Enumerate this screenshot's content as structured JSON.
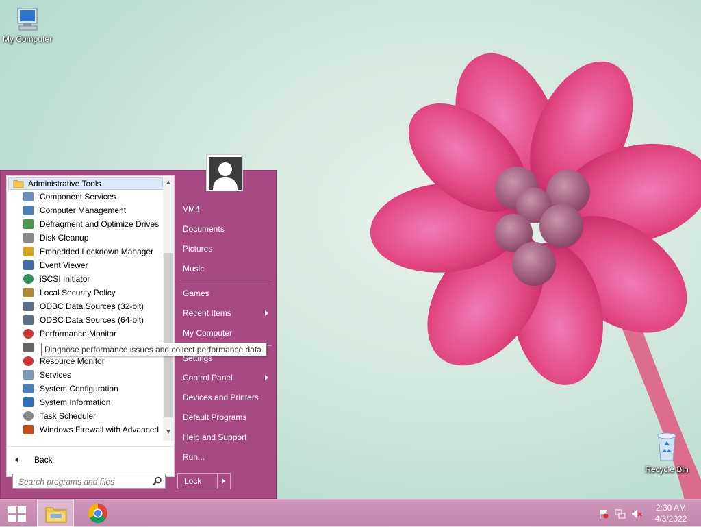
{
  "desktop": {
    "icons": [
      {
        "label": "My Computer",
        "icon": "computer-icon"
      },
      {
        "label": "Recycle Bin",
        "icon": "recycle-bin-icon"
      }
    ]
  },
  "start_menu": {
    "header": "Administrative Tools",
    "programs": [
      {
        "label": "Component Services",
        "icon": "component-services-icon"
      },
      {
        "label": "Computer Management",
        "icon": "computer-management-icon"
      },
      {
        "label": "Defragment and Optimize Drives",
        "icon": "defragment-icon"
      },
      {
        "label": "Disk Cleanup",
        "icon": "disk-cleanup-icon"
      },
      {
        "label": "Embedded Lockdown Manager",
        "icon": "lock-icon"
      },
      {
        "label": "Event Viewer",
        "icon": "event-viewer-icon"
      },
      {
        "label": "iSCSI Initiator",
        "icon": "globe-icon"
      },
      {
        "label": "Local Security Policy",
        "icon": "security-policy-icon"
      },
      {
        "label": "ODBC Data Sources (32-bit)",
        "icon": "odbc-icon"
      },
      {
        "label": "ODBC Data Sources (64-bit)",
        "icon": "odbc-icon"
      },
      {
        "label": "Performance Monitor",
        "icon": "performance-monitor-icon"
      },
      {
        "label": "",
        "icon": "print-management-icon"
      },
      {
        "label": "Resource Monitor",
        "icon": "resource-monitor-icon"
      },
      {
        "label": "Services",
        "icon": "services-gear-icon"
      },
      {
        "label": "System Configuration",
        "icon": "system-configuration-icon"
      },
      {
        "label": "System Information",
        "icon": "system-information-icon"
      },
      {
        "label": "Task Scheduler",
        "icon": "clock-icon"
      },
      {
        "label": "Windows Firewall with Advanced",
        "icon": "firewall-icon"
      }
    ],
    "back_label": "Back",
    "search_placeholder": "Search programs and files",
    "tooltip": "Diagnose performance issues and collect performance data.",
    "right_items": [
      {
        "label": "VM4",
        "arrow": false
      },
      {
        "label": "Documents",
        "arrow": false
      },
      {
        "label": "Pictures",
        "arrow": false
      },
      {
        "label": "Music",
        "arrow": false
      },
      {
        "label": "Games",
        "arrow": false
      },
      {
        "label": "Recent Items",
        "arrow": true
      },
      {
        "label": "My Computer",
        "arrow": false
      },
      {
        "label": "Settings",
        "arrow": false
      },
      {
        "label": "Control Panel",
        "arrow": true
      },
      {
        "label": "Devices and Printers",
        "arrow": false
      },
      {
        "label": "Default Programs",
        "arrow": false
      },
      {
        "label": "Help and Support",
        "arrow": false
      },
      {
        "label": "Run...",
        "arrow": false
      }
    ],
    "lock_label": "Lock"
  },
  "taskbar": {
    "clock_time": "2:30 AM",
    "clock_date": "4/3/2022",
    "colors": {
      "accent": "#a84a82",
      "taskbar": "#c68ab0"
    }
  }
}
